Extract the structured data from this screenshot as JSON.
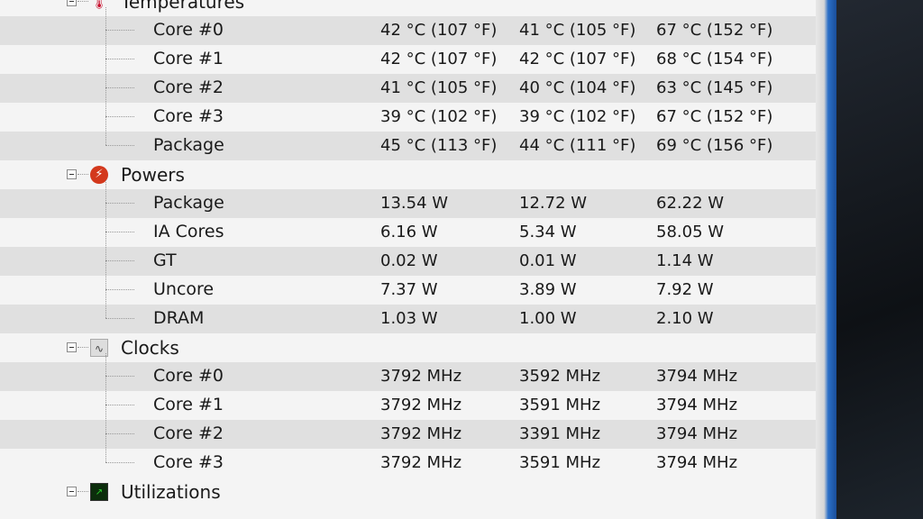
{
  "groups": [
    {
      "label": "Temperatures",
      "icon": "thermometer-icon",
      "rows": [
        {
          "name": "Core #0",
          "current": "42 °C  (107 °F)",
          "min": "41 °C  (105 °F)",
          "max": "67 °C  (152 °F)"
        },
        {
          "name": "Core #1",
          "current": "42 °C  (107 °F)",
          "min": "42 °C  (107 °F)",
          "max": "68 °C  (154 °F)"
        },
        {
          "name": "Core #2",
          "current": "41 °C  (105 °F)",
          "min": "40 °C  (104 °F)",
          "max": "63 °C  (145 °F)"
        },
        {
          "name": "Core #3",
          "current": "39 °C  (102 °F)",
          "min": "39 °C  (102 °F)",
          "max": "67 °C  (152 °F)"
        },
        {
          "name": "Package",
          "current": "45 °C  (113 °F)",
          "min": "44 °C  (111 °F)",
          "max": "69 °C  (156 °F)"
        }
      ]
    },
    {
      "label": "Powers",
      "icon": "power-icon",
      "rows": [
        {
          "name": "Package",
          "current": "13.54 W",
          "min": "12.72 W",
          "max": "62.22 W"
        },
        {
          "name": "IA Cores",
          "current": "6.16 W",
          "min": "5.34 W",
          "max": "58.05 W"
        },
        {
          "name": "GT",
          "current": "0.02 W",
          "min": "0.01 W",
          "max": "1.14 W"
        },
        {
          "name": "Uncore",
          "current": "7.37 W",
          "min": "3.89 W",
          "max": "7.92 W"
        },
        {
          "name": "DRAM",
          "current": "1.03 W",
          "min": "1.00 W",
          "max": "2.10 W"
        }
      ]
    },
    {
      "label": "Clocks",
      "icon": "clock-wave-icon",
      "rows": [
        {
          "name": "Core #0",
          "current": "3792 MHz",
          "min": "3592 MHz",
          "max": "3794 MHz"
        },
        {
          "name": "Core #1",
          "current": "3792 MHz",
          "min": "3591 MHz",
          "max": "3794 MHz"
        },
        {
          "name": "Core #2",
          "current": "3792 MHz",
          "min": "3391 MHz",
          "max": "3794 MHz"
        },
        {
          "name": "Core #3",
          "current": "3792 MHz",
          "min": "3591 MHz",
          "max": "3794 MHz"
        }
      ]
    },
    {
      "label": "Utilizations",
      "icon": "utilization-graph-icon",
      "rows": []
    }
  ]
}
